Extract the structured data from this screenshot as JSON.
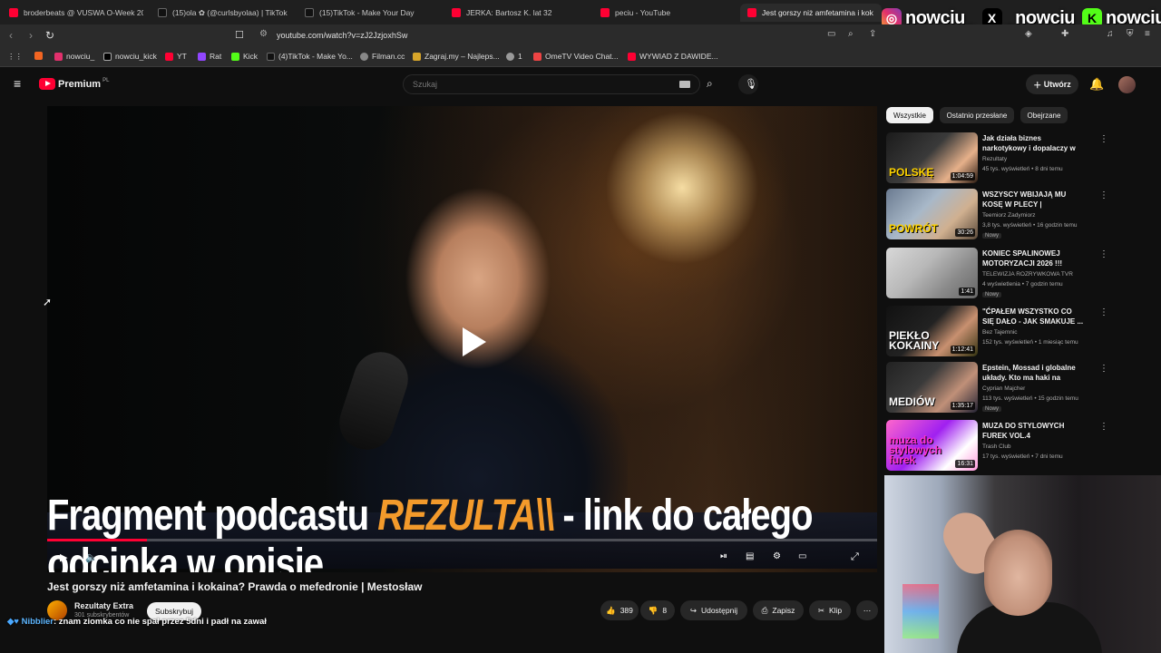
{
  "browser": {
    "tabs": [
      {
        "label": "broderbeats @ VUSWA O-Week 202",
        "icon": "youtube-icon"
      },
      {
        "label": "(15)ola ✿ (@curlsbyolaa) | TikTok",
        "icon": "tiktok-icon"
      },
      {
        "label": "(15)TikTok - Make Your Day",
        "icon": "tiktok-icon"
      },
      {
        "label": "JERKA: Bartosz K. lat 32",
        "icon": "youtube-icon"
      },
      {
        "label": "peciu - YouTube",
        "icon": "youtube-icon"
      },
      {
        "label": "Jest gorszy niż amfetamina i kok",
        "icon": "youtube-icon",
        "active": true
      }
    ],
    "url": "youtube.com/watch?v=zJ2JzjoxhSw",
    "bookmarks": [
      "nowciu_",
      "nowciu_kick",
      "YT",
      "Rat",
      "Kick",
      "(4)TikTok - Make Yo...",
      "Filman.cc",
      "Zagraj.my – Najleps...",
      "1",
      "OmeTV Video Chat...",
      "WYWIAD Z DAWIDE..."
    ]
  },
  "overlay": {
    "handles": [
      "nowciu_",
      "_nowciu",
      "nowciu"
    ]
  },
  "youtube": {
    "logo_text": "Premium",
    "region": "PL",
    "search_placeholder": "Szukaj",
    "create_label": "Utwórz"
  },
  "video": {
    "banner_prefix": "Fragment podcastu",
    "banner_brand": "REZULTA\\\\",
    "banner_suffix": "- link do całego odcinka w opisie",
    "progress": 0.12,
    "title": "Jest gorszy niż amfetamina i kokaina? Prawda o mefedronie | Mestosław",
    "channel_name": "Rezultaty Extra",
    "channel_subs": "301 subskrybentów",
    "subscribe_label": "Subskrybuj",
    "likes": "389",
    "dislikes": "8",
    "share_label": "Udostępnij",
    "save_label": "Zapisz",
    "clip_label": "Klip"
  },
  "chat": {
    "user": "Nibblier",
    "message": ": znam ziomka co nie spał przez 5dni i padł na zawał"
  },
  "sidebar": {
    "chips": [
      "Wszystkie",
      "Ostatnio przesłane",
      "Obejrzane"
    ],
    "videos": [
      {
        "title": "Jak działa biznes narkotykowy i dopalaczy w Polsce? | ...",
        "channel": "Rezultaty",
        "meta": "45 tys. wyświetleń • 8 dni temu",
        "duration": "1:04:59",
        "badge": "",
        "thumb_text": "POLSKĘ"
      },
      {
        "title": "WSZYSCY WBIJAJĄ MU KOSĘ W PLECY | RANDOMBRUCETV",
        "channel": "Teemiorz Zadymiorz",
        "meta": "3,8 tys. wyświetleń • 16 godzin temu",
        "duration": "30:26",
        "badge": "Nowy",
        "thumb_text": "POWRÓT"
      },
      {
        "title": "KONIEC SPALINOWEJ MOTORYZACJI 2026 !!!",
        "channel": "TELEWIZJA ROZRYWKOWA TVR",
        "meta": "4 wyświetlenia • 7 godzin temu",
        "duration": "1:41",
        "badge": "Nowy",
        "thumb_text": ""
      },
      {
        "title": "\"ĆPAŁEM WSZYSTKO CO SIĘ DAŁO - JAK SMAKUJE ...",
        "channel": "Bez Tajemnic",
        "meta": "152 tys. wyświetleń • 1 miesiąc temu",
        "duration": "1:12:41",
        "badge": "",
        "thumb_text": "PIEKŁO KOKAINY"
      },
      {
        "title": "Epstein, Mossad i globalne układy. Kto ma haki na polskie...",
        "channel": "Cyprian Majcher",
        "meta": "113 tys. wyświetleń • 15 godzin temu",
        "duration": "1:35:17",
        "badge": "Nowy",
        "thumb_text": "MEDIÓW"
      },
      {
        "title": "MUZA DO STYLOWYCH FUREK VOL.4",
        "channel": "Trash Club",
        "meta": "17 tys. wyświetleń • 7 dni temu",
        "duration": "16:31",
        "badge": "",
        "thumb_text": "muza do stylowych furek"
      }
    ]
  },
  "colors": {
    "youtube_red": "#ff0033",
    "banner_accent": "#f39a2b",
    "chat_user": "#5db6ff",
    "kick_green": "#53fc18"
  }
}
